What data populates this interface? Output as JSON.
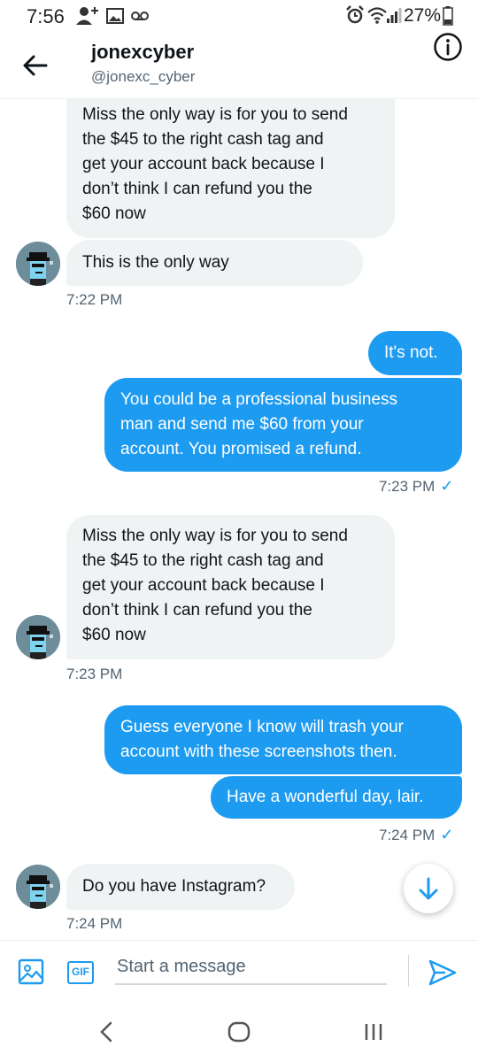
{
  "status_bar": {
    "time": "7:56",
    "battery": "27%"
  },
  "header": {
    "name": "jonexcyber",
    "handle": "@jonexc_cyber"
  },
  "messages": [
    {
      "text_lines": [
        "Miss the only way is for you to send",
        "the $45 to the right cash tag and",
        "get your account back because I",
        "don’t think I can refund you the",
        "$60 now"
      ]
    },
    {
      "text": "This is the only way"
    },
    {
      "time": "7:22 PM"
    },
    {
      "text": "It's not."
    },
    {
      "text_lines": [
        "You could be a professional business",
        "man and send me $60 from your",
        "account. You promised a refund."
      ]
    },
    {
      "time": "7:23 PM"
    },
    {
      "text_lines": [
        "Miss the only way is for you to send",
        "the $45 to the right cash tag and",
        "get your account back because I",
        "don’t think I can refund you the",
        "$60 now"
      ]
    },
    {
      "time": "7:23 PM"
    },
    {
      "text_lines": [
        "Guess everyone I know will trash your",
        "account with these screenshots then."
      ]
    },
    {
      "text": "Have a wonderful day, lair."
    },
    {
      "time": "7:24 PM"
    },
    {
      "text": "Do you have Instagram?"
    },
    {
      "time": "7:24 PM"
    }
  ],
  "composer": {
    "placeholder": "Start a message",
    "gif_label": "GIF"
  },
  "icons": {
    "back": "arrow-left-icon",
    "info": "info-icon",
    "image": "image-icon",
    "gif": "gif-icon",
    "send": "send-icon",
    "scroll_down": "arrow-down-icon",
    "read_receipt": "checkmark-icon"
  },
  "colors": {
    "accent": "#1d9bf0",
    "received_bubble": "#eff3f4",
    "secondary_text": "#536471"
  }
}
